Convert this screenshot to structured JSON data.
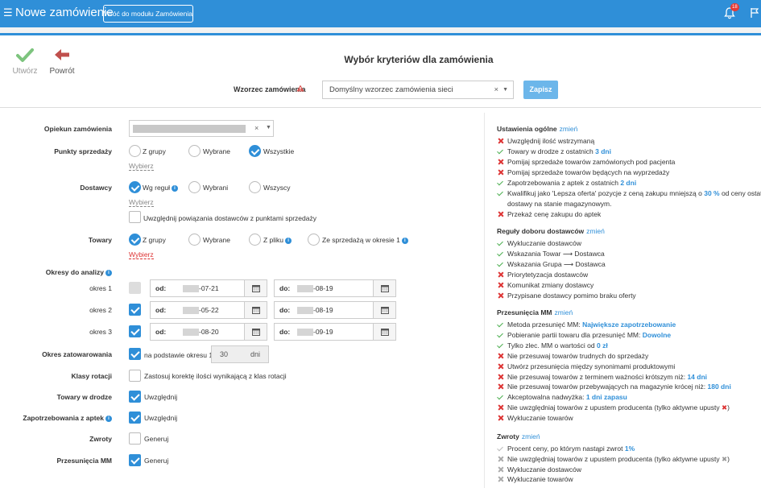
{
  "header": {
    "title": "Nowe zamówienie",
    "back_module_label": "Wróć do modułu Zamówienia",
    "notifications_count": "18",
    "accent_color": "#2f8fd8"
  },
  "actions": {
    "create_label": "Utwórz",
    "back_label": "Powrót"
  },
  "page_title": "Wybór kryteriów dla zamówienia",
  "template": {
    "label": "Wzorzec zamówienia",
    "value": "Domyślny wzorzec zamówienia sieci",
    "save_label": "Zapisz"
  },
  "form": {
    "owner_label": "Opiekun zamówienia",
    "pos": {
      "label": "Punkty sprzedaży",
      "options": [
        "Z grupy",
        "Wybrane",
        "Wszystkie"
      ],
      "selected": "Wszystkie",
      "link": "Wybierz"
    },
    "suppliers": {
      "label": "Dostawcy",
      "options": [
        "Wg reguł",
        "Wybrani",
        "Wszyscy"
      ],
      "selected": "Wg reguł",
      "link": "Wybierz",
      "link_checkbox": "Uwzględnij powiązania dostawców z punktami sprzedaży"
    },
    "goods": {
      "label": "Towary",
      "options": [
        "Z grupy",
        "Wybrane",
        "Z pliku",
        "Ze sprzedażą w okresie 1"
      ],
      "selected": "Z grupy",
      "link": "Wybierz"
    },
    "periods": {
      "label": "Okresy do analizy",
      "from_label": "od:",
      "to_label": "do:",
      "rows": [
        {
          "name": "okres 1",
          "checked": true,
          "disabled": true,
          "from": "-07-21",
          "to": "-08-19"
        },
        {
          "name": "okres 2",
          "checked": true,
          "disabled": false,
          "from": "-05-22",
          "to": "-08-19"
        },
        {
          "name": "okres 3",
          "checked": true,
          "disabled": false,
          "from": "-08-20",
          "to": "-09-19"
        }
      ]
    },
    "stock_period": {
      "label": "Okres zatowarowania",
      "checkbox_label": "na podstawie okresu 1",
      "value": "30",
      "unit": "dni"
    },
    "rotation": {
      "label": "Klasy rotacji",
      "checkbox_label": "Zastosuj korektę ilości wynikającą z klas rotacji"
    },
    "goods_transit": {
      "label": "Towary w drodze",
      "checkbox_label": "Uwzględnij"
    },
    "pharmacy_demand": {
      "label": "Zapotrzebowania z aptek",
      "checkbox_label": "Uwzględnij"
    },
    "returns": {
      "label": "Zwroty",
      "checkbox_label": "Generuj"
    },
    "mm_moves": {
      "label": "Przesunięcia MM",
      "checkbox_label": "Generuj"
    }
  },
  "right_panel": {
    "change_label": "zmień",
    "general": {
      "title": "Ustawienia ogólne",
      "items": [
        {
          "ok": false,
          "text": "Uwzględnij ilość wstrzymaną"
        },
        {
          "ok": true,
          "text": "Towary w drodze z ostatnich",
          "hl": "3 dni"
        },
        {
          "ok": false,
          "text": "Pomijaj sprzedaże towarów zamówionych pod pacjenta"
        },
        {
          "ok": false,
          "text": "Pomijaj sprzedaże towarów będących na wyprzedaży"
        },
        {
          "ok": true,
          "text": "Zapotrzebowania z aptek z ostatnich",
          "hl": "2 dni"
        },
        {
          "ok": true,
          "text": "Kwalifikuj jako 'Lepsza oferta' pozycje z ceną zakupu mniejszą o",
          "hl": "30 %",
          "tail": "od ceny ostatniej",
          "line2": "dostawy na stanie magazynowym."
        },
        {
          "ok": false,
          "text": "Przekaż cenę zakupu do aptek"
        }
      ]
    },
    "rules": {
      "title": "Reguły doboru dostawców",
      "items": [
        {
          "ok": true,
          "text": "Wykluczanie dostawców"
        },
        {
          "ok": true,
          "text": "Wskazania Towar ⟶ Dostawca"
        },
        {
          "ok": true,
          "text": "Wskazania Grupa ⟶ Dostawca"
        },
        {
          "ok": false,
          "text": "Priorytetyzacja dostawców"
        },
        {
          "ok": false,
          "text": "Komunikat zmiany dostawcy"
        },
        {
          "ok": false,
          "text": "Przypisane dostawcy pomimo braku oferty"
        }
      ]
    },
    "mm": {
      "title": "Przesunięcia MM",
      "items": [
        {
          "ok": true,
          "text": "Metoda przesunięć MM:",
          "hl": "Największe zapotrzebowanie"
        },
        {
          "ok": true,
          "text": "Pobieranie partii towaru dla przesunięć MM:",
          "hl": "Dowolne"
        },
        {
          "ok": true,
          "text": "Tylko zlec. MM o wartości od",
          "hl": "0 zł"
        },
        {
          "ok": false,
          "text": "Nie przesuwaj towarów trudnych do sprzedaży"
        },
        {
          "ok": false,
          "text": "Utwórz przesunięcia między synonimami produktowymi"
        },
        {
          "ok": false,
          "text": "Nie przesuwaj towarów z terminem ważności krótszym niż:",
          "hl": "14 dni"
        },
        {
          "ok": false,
          "text": "Nie przesuwaj towarów przebywających na magazynie krócej niż:",
          "hl": "180 dni"
        },
        {
          "ok": true,
          "text": "Akceptowalna nadwyżka:",
          "hl": "1 dni zapasu"
        },
        {
          "ok": false,
          "text": "Nie uwzględniaj towarów z upustem producenta (tylko aktywne upusty",
          "tail": ")",
          "redx": true
        },
        {
          "ok": false,
          "text": "Wykluczanie towarów"
        }
      ]
    },
    "returns": {
      "title": "Zwroty",
      "items": [
        {
          "ok": true,
          "text": "Procent ceny, po którym nastąpi zwrot",
          "hl": "1%"
        },
        {
          "ok": false,
          "text": "Nie uwzględniaj towarów z upustem producenta (tylko aktywne upusty",
          "tail": ")",
          "grayx": true
        },
        {
          "ok": false,
          "text": "Wykluczanie dostawców"
        },
        {
          "ok": false,
          "text": "Wykluczanie towarów"
        }
      ]
    }
  }
}
